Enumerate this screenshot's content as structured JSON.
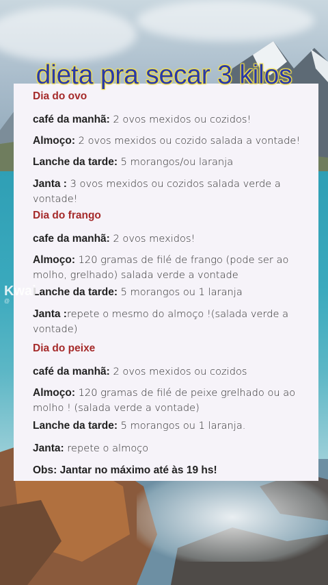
{
  "title": "dieta pra secar 3 kilos",
  "watermark": {
    "brand": "Kwai",
    "handle": "@"
  },
  "sections": [
    {
      "heading": "Dia do ovo",
      "items": [
        {
          "label": "café da manhã:",
          "text": " 2 ovos mexidos ou cozidos!"
        },
        {
          "label": "Almoço:",
          "text": " 2 ovos mexidos ou cozido salada a vontade!"
        },
        {
          "label": "Lanche da tarde:",
          "text": " 5 morangos/ou laranja"
        },
        {
          "label": "Janta :",
          "text": " 3 ovos mexidos ou cozidos salada verde a vontade!"
        }
      ]
    },
    {
      "heading": "Dia do frango",
      "items": [
        {
          "label": "cafe da manhã:",
          "text": " 2 ovos mexidos!"
        },
        {
          "label": "Almoço:",
          "text": " 120 gramas de filé de frango (pode ser ao molho, grelhado) salada verde a vontade"
        },
        {
          "label": "Lanche da tarde:",
          "text": " 5 morangos ou 1 laranja"
        },
        {
          "label": "Janta :",
          "text": "repete o mesmo do almoço !(salada verde a vontade)"
        }
      ]
    },
    {
      "heading": "Dia do peixe",
      "items": [
        {
          "label": "café da manhã:",
          "text": " 2 ovos mexidos ou cozidos"
        },
        {
          "label": "Almoço:",
          "text": " 120 gramas de filé de peixe grelhado ou ao molho ! (salada verde a vontade)"
        },
        {
          "label": "Lanche da tarde:",
          "text": " 5 morangos ou 1 laranja."
        },
        {
          "label": "Janta:",
          "text": " repete o almoço"
        }
      ]
    }
  ],
  "obs": "Obs: Jantar no máximo até às 19 hs!",
  "colors": {
    "heading": "#a52a2a",
    "title": "#2a3aa8",
    "title_glow": "#f4e04a",
    "card": "#f6f3f9"
  }
}
